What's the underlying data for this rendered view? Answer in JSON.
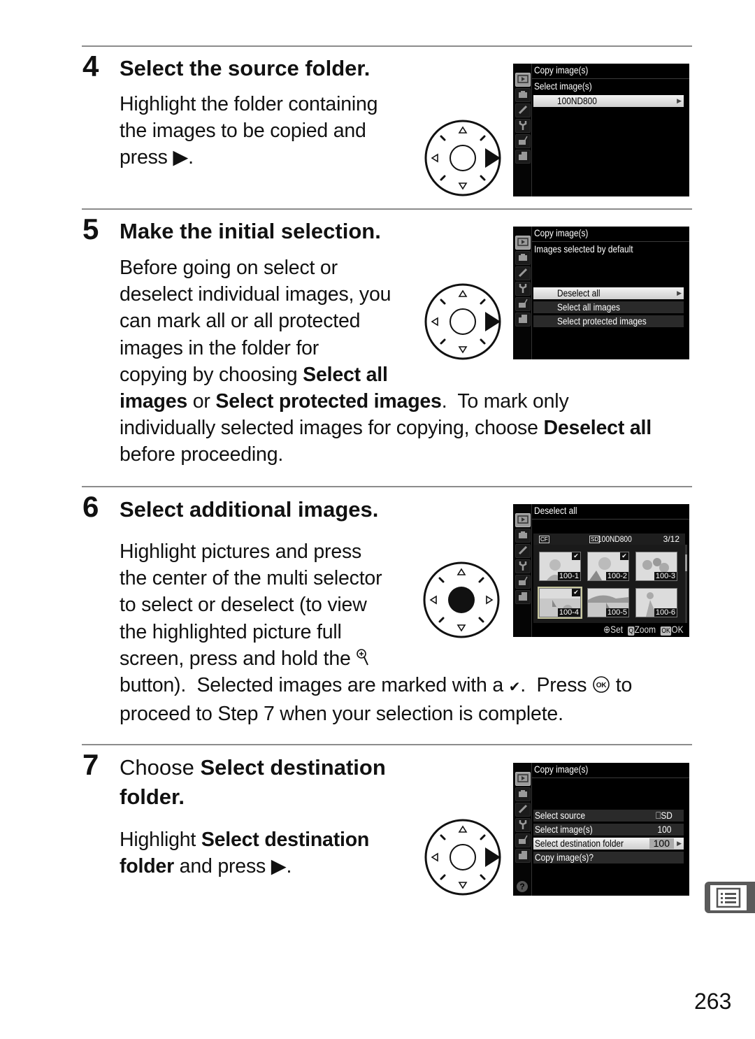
{
  "steps": [
    {
      "number": "4",
      "title": "Select the source folder.",
      "body_lines": [
        "Highlight the folder containing",
        "the images to be copied and",
        "press "
      ],
      "body_end": ".",
      "multi_selector": "right-pressed",
      "screen": {
        "header": "Copy image(s)",
        "subheader": "Select image(s)",
        "rows": [
          {
            "label": "100ND800",
            "highlighted": true,
            "arrow": true
          }
        ]
      }
    },
    {
      "number": "5",
      "title": "Make the initial selection.",
      "body": {
        "l1": "Before going on select or",
        "l2": "deselect individual images, you",
        "l3": "can mark all or all protected",
        "l4": "images in the folder for",
        "l5a": "copying by choosing ",
        "l5b": "Select all",
        "l6a": "images",
        "l6b": " or ",
        "l6c": "Select protected images",
        "l6d": ".  To mark only",
        "l7a": "individually selected images for copying, choose ",
        "l7b": "Deselect all",
        "l8": "before proceeding."
      },
      "multi_selector": "right-pressed",
      "screen": {
        "header": "Copy image(s)",
        "subheader": "Images selected by default",
        "rows": [
          {
            "label": "Deselect all",
            "highlighted": true,
            "arrow": true
          },
          {
            "label": "Select all images",
            "highlighted": false
          },
          {
            "label": "Select protected images",
            "highlighted": false
          }
        ]
      }
    },
    {
      "number": "6",
      "title": "Select additional images.",
      "body": {
        "l1": "Highlight pictures and press",
        "l2": "the center of the multi selector",
        "l3": "to select or deselect (to view",
        "l4": "the highlighted picture full",
        "l5": "screen, press and hold the ",
        "l6a": "button).  Selected images are marked with a ",
        "l6b": ".  Press ",
        "l6c": " to",
        "l7": "proceed to Step 7 when your selection is complete."
      },
      "multi_selector": "center-pressed",
      "screen": {
        "header": "Deselect all",
        "source_card": "CF",
        "folder_card": "SD",
        "folder": "100ND800",
        "counter": "3/12",
        "thumbnails": [
          {
            "label": "100-1",
            "checked": true,
            "highlighted": false
          },
          {
            "label": "100-2",
            "checked": true,
            "highlighted": false
          },
          {
            "label": "100-3",
            "checked": false,
            "highlighted": false
          },
          {
            "label": "100-4",
            "checked": true,
            "highlighted": true
          },
          {
            "label": "100-5",
            "checked": false,
            "highlighted": false
          },
          {
            "label": "100-6",
            "checked": false,
            "highlighted": false
          }
        ],
        "footer": {
          "set": "Set",
          "zoom": "Zoom",
          "ok_icon": "OK",
          "ok": "OK"
        }
      }
    },
    {
      "number": "7",
      "title_reg": "Choose ",
      "title_bold": "Select destination",
      "title_line2": "folder.",
      "body": {
        "l1a": "Highlight ",
        "l1b": "Select destination",
        "l2a": "folder",
        "l2b": " and press "
      },
      "body_end": ".",
      "multi_selector": "right-pressed",
      "screen": {
        "header": "Copy image(s)",
        "rows": [
          {
            "label": "Select source",
            "value": "SD",
            "highlighted": false
          },
          {
            "label": "Select image(s)",
            "value": "100",
            "highlighted": false
          },
          {
            "label": "Select destination folder",
            "value": "100",
            "highlighted": true,
            "arrow": true
          },
          {
            "label": "Copy image(s)?",
            "value": "",
            "highlighted": false
          }
        ],
        "help_icon": "?"
      }
    }
  ],
  "glyphs": {
    "right_triangle": "▶",
    "check": "✔",
    "ok": "®",
    "arrow_small": "▶"
  },
  "side_tab_icon": "menu-list-icon",
  "page_number": "263"
}
